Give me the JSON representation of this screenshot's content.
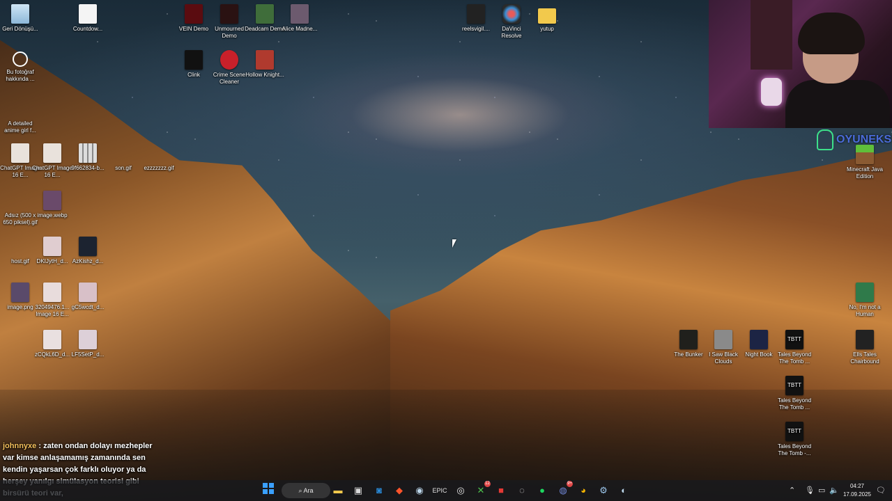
{
  "desktop_icons": {
    "recycle_bin": "Geri Dönüşü...",
    "countdown": "Countdow...",
    "vein": "VEIN Demo",
    "unmourned": "Unmourned Demo",
    "deadcam": "Deadcam Demo",
    "alice": "Alice Madne...",
    "reelsvigil": "reelsvigil....",
    "davinci": "DaVinci Resolve",
    "yutup": "yutup",
    "bu_fotograf": "Bu fotoğraf hakkında ...",
    "clink": "Clink",
    "crime_scene": "Crime Scene Cleaner",
    "hollow_knight": "Hollow Knight...",
    "anime_girl": "A detailed anime girl f...",
    "chatgpt1": "ChatGPT Image 16 E...",
    "chatgpt2": "ChatGPT Image 16 E...",
    "grid_img": "9f662834-b...",
    "son_gif": "son.gif",
    "ezzz_gif": "ezzzzzzz.gif",
    "adsiz": "Adsız (500 x 650 piksel).gif",
    "image_webp": "image.webp",
    "host_gif": "host.gif",
    "dklly": "DKIJytH_d...",
    "azkishz": "AzKishz_d...",
    "image_png": "image.png",
    "img32049": "32049476.1... Image 16 E...",
    "gc5": "gC5wcdt_d...",
    "zcqk": "zCQkL6D_d...",
    "lf5": "LF5SetP_d...",
    "minecraft": "Minecraft Java Edition",
    "no_human": "No, I'm not a Human",
    "the_bunker": "The Bunker",
    "i_saw": "I Saw Black Clouds",
    "night_book": "Night Book",
    "tbtt1": "Tales Beyond The Tomb ...",
    "ells_tales": "Ells Tales Chairbound",
    "tbtt2": "Tales Beyond The Tomb ...",
    "tbtt3": "Tales Beyond The Tomb -..."
  },
  "chat": {
    "user": "johnnyxe",
    "message": " : zaten ondan dolayı mezhepler var kimse anlaşamamış zamanında sen kendin yaşarsan çok farklı oluyor ya da herşey yanılgı simülasyon teorisi gibi birsürü teori var,"
  },
  "overlay": {
    "logo_text": "OYUNEKS"
  },
  "taskbar": {
    "search_label": "Ara",
    "apps": [
      "windows-icon",
      "search",
      "file-explorer-icon",
      "store-icon",
      "outlook-icon",
      "brave-icon",
      "steam-icon",
      "epic-icon",
      "obs-icon",
      "xbox-icon",
      "app-red-icon",
      "app-dots-icon",
      "spotify-icon",
      "discord-icon",
      "chrome-icon",
      "app-gear-icon",
      "steam-alt-icon"
    ],
    "xbox_badge": "12",
    "discord_badge": "9+",
    "tray": {
      "time": "04:27",
      "date": "17.09.2025"
    }
  }
}
